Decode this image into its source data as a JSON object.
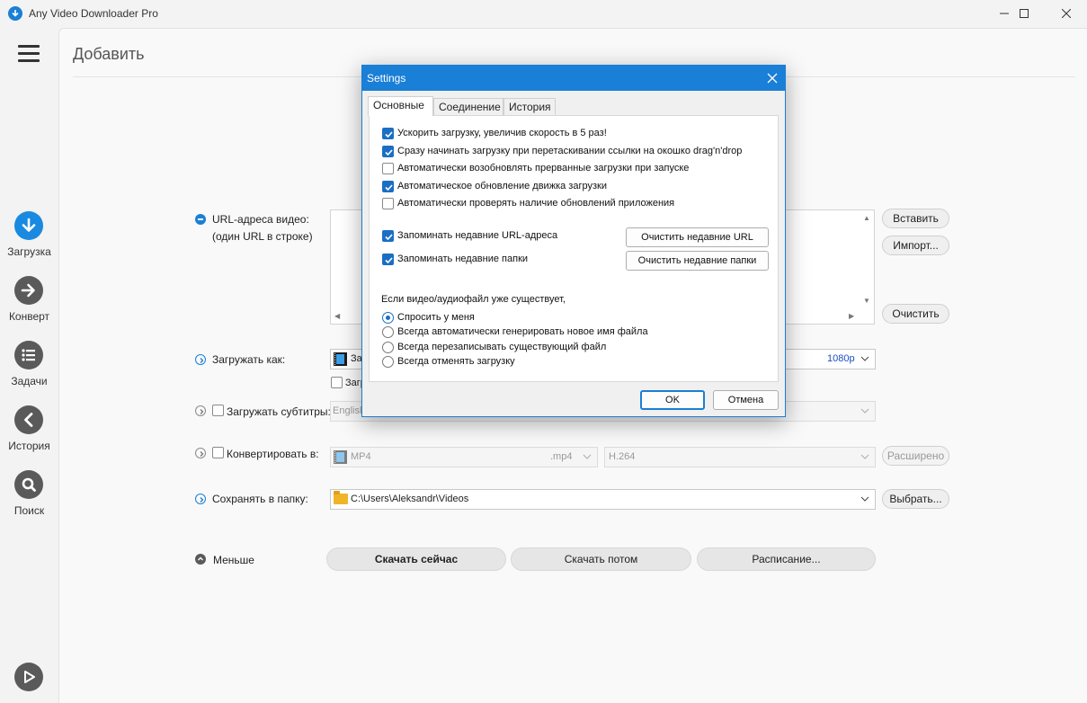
{
  "window": {
    "title": "Any Video Downloader Pro"
  },
  "nav": {
    "items": [
      {
        "label": "Загрузка",
        "icon": "download-arrow-icon"
      },
      {
        "label": "Конверт",
        "icon": "convert-arrow-icon"
      },
      {
        "label": "Задачи",
        "icon": "task-list-icon"
      },
      {
        "label": "История",
        "icon": "history-back-icon"
      },
      {
        "label": "Поиск",
        "icon": "search-icon"
      }
    ]
  },
  "main": {
    "title": "Добавить",
    "url_label_1": "URL-адреса видео:",
    "url_label_2": "(один URL в строке)",
    "paste_button": "Вставить",
    "import_button": "Импорт...",
    "clear_button": "Очистить",
    "download_as_label": "Загружать как:",
    "download_as_value": "За",
    "quality_value": "1080p",
    "download_audio_checkbox": "Загр",
    "subtitles_label": "Загружать субтитры:",
    "subtitles_value": "English",
    "convert_label": "Конвертировать в:",
    "convert_format": "MP4",
    "convert_ext": ".mp4",
    "convert_codec": "H.264",
    "advanced_button": "Расширено",
    "save_to_label": "Сохранять в папку:",
    "save_to_value": "C:\\Users\\Aleksandr\\Videos",
    "browse_button": "Выбрать...",
    "less_label": "Меньше",
    "download_now_button": "Скачать сейчас",
    "download_later_button": "Скачать потом",
    "schedule_button": "Расписание..."
  },
  "dialog": {
    "title": "Settings",
    "tabs": [
      "Основные",
      "Соединение",
      "История"
    ],
    "options": [
      {
        "label": "Ускорить загрузку, увеличив скорость в 5 раз!",
        "checked": true
      },
      {
        "label": "Сразу начинать загрузку при перетаскивании ссылки на окошко drag'n'drop",
        "checked": true
      },
      {
        "label": "Автоматически возобновлять прерванные загрузки при запуске",
        "checked": false
      },
      {
        "label": "Автоматическое обновление движка загрузки",
        "checked": true
      },
      {
        "label": "Автоматически проверять наличие обновлений приложения",
        "checked": false
      }
    ],
    "remember_urls": {
      "label": "Запоминать недавние URL-адреса",
      "checked": true
    },
    "remember_folders": {
      "label": "Запоминать недавние папки",
      "checked": true
    },
    "clear_urls_button": "Очистить недавние URL",
    "clear_folders_button": "Очистить недавние папки",
    "exists_label": "Если видео/аудиофайл уже существует,",
    "exists_options": [
      {
        "label": "Спросить у меня",
        "selected": true
      },
      {
        "label": "Всегда автоматически генерировать новое имя файла",
        "selected": false
      },
      {
        "label": "Всегда перезаписывать существующий файл",
        "selected": false
      },
      {
        "label": "Всегда отменять загрузку",
        "selected": false
      }
    ],
    "ok_button": "OK",
    "cancel_button": "Отмена"
  },
  "colors": {
    "accent": "#1a7fd6",
    "nav_active": "#1a8ae0",
    "nav_inactive": "#5a5a5a"
  }
}
